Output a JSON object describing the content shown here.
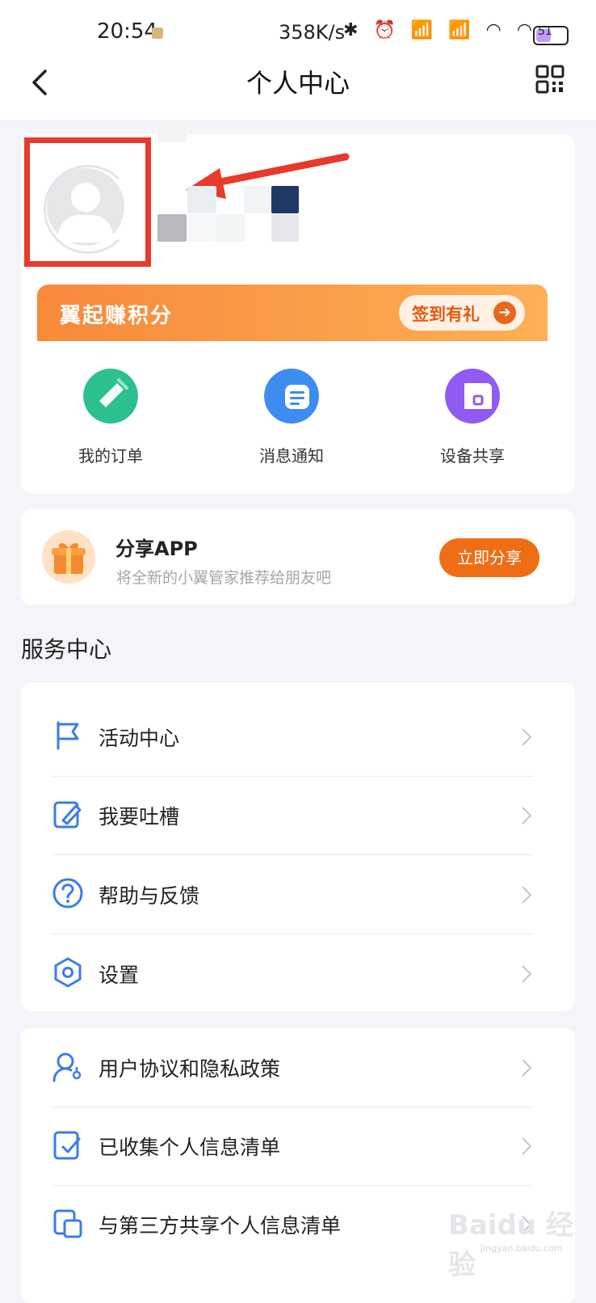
{
  "status_bar": {
    "time": "20:54",
    "speed": "358K/s",
    "icons": [
      "bluetooth-icon",
      "alarm-icon",
      "signal-hd-icon",
      "signal-hd-icon",
      "wifi-icon",
      "wifi-icon"
    ],
    "battery": "51",
    "battery_level": 0.51
  },
  "nav": {
    "title": "个人中心",
    "back_icon": "chevron-left-icon",
    "qr_icon": "qr-code-icon"
  },
  "profile": {
    "points_banner_title": "翼起赚积分",
    "checkin_label": "签到有礼",
    "checkin_arrow": "➔"
  },
  "quick_actions": [
    {
      "label": "我的订单",
      "icon": "order-icon",
      "color": "#2cc08d"
    },
    {
      "label": "消息通知",
      "icon": "message-icon",
      "color": "#3d8cf0"
    },
    {
      "label": "设备共享",
      "icon": "device-share-icon",
      "color": "#8f5bf2"
    }
  ],
  "share": {
    "title": "分享APP",
    "subtitle": "将全新的小翼管家推荐给朋友吧",
    "button": "立即分享"
  },
  "service_center": {
    "title": "服务中心",
    "items": [
      {
        "label": "活动中心",
        "icon": "flag-icon"
      },
      {
        "label": "我要吐槽",
        "icon": "edit-icon"
      },
      {
        "label": "帮助与反馈",
        "icon": "help-icon"
      },
      {
        "label": "设置",
        "icon": "settings-icon"
      }
    ]
  },
  "privacy": {
    "items": [
      {
        "label": "用户协议和隐私政策",
        "icon": "user-key-icon"
      },
      {
        "label": "已收集个人信息清单",
        "icon": "checklist-icon"
      },
      {
        "label": "与第三方共享个人信息清单",
        "icon": "share-list-icon"
      }
    ]
  },
  "watermark": {
    "text": "Baidu 经验",
    "sub": "jingyan.baidu.com"
  },
  "colors": {
    "accent_orange": "#ef6d15",
    "icon_blue": "#3b7de8",
    "annotation_red": "#e73a2b"
  }
}
